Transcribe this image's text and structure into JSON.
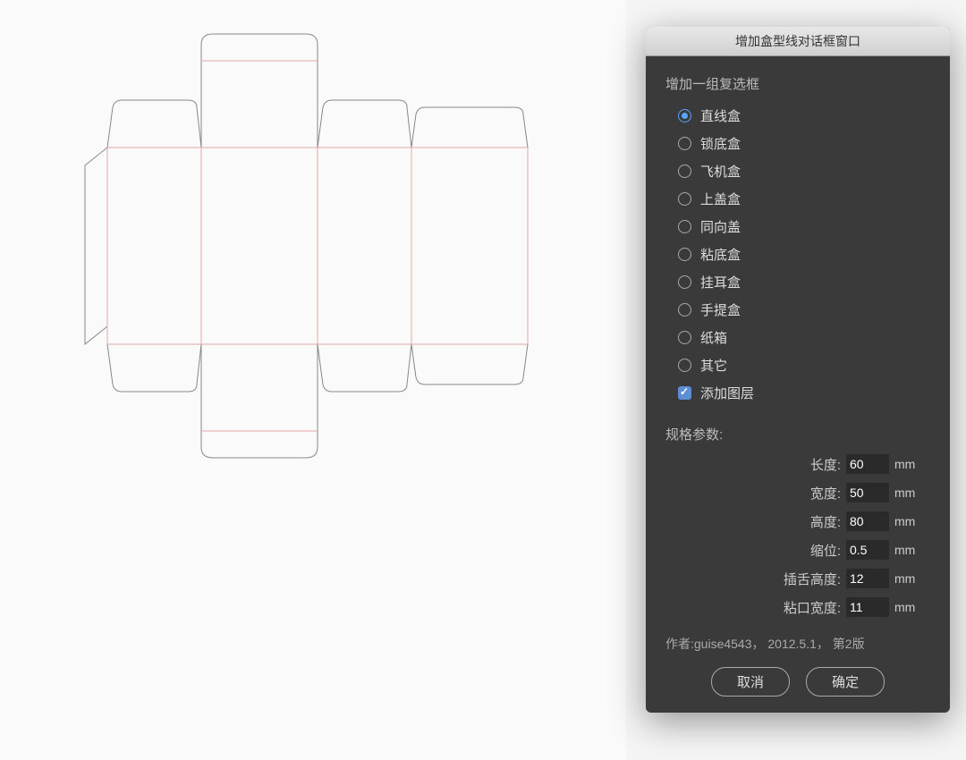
{
  "dialog": {
    "title": "增加盒型线对话框窗口",
    "group_label": "增加一组复选框",
    "options": [
      {
        "label": "直线盒",
        "selected": true
      },
      {
        "label": "锁底盒",
        "selected": false
      },
      {
        "label": "飞机盒",
        "selected": false
      },
      {
        "label": "上盖盒",
        "selected": false
      },
      {
        "label": "同向盖",
        "selected": false
      },
      {
        "label": "粘底盒",
        "selected": false
      },
      {
        "label": "挂耳盒",
        "selected": false
      },
      {
        "label": "手提盒",
        "selected": false
      },
      {
        "label": "纸箱",
        "selected": false
      },
      {
        "label": "其它",
        "selected": false
      }
    ],
    "checkbox": {
      "label": "添加图层",
      "checked": true
    },
    "params_label": "规格参数:",
    "params": [
      {
        "name": "长度:",
        "value": "60",
        "unit": "mm"
      },
      {
        "name": "宽度:",
        "value": "50",
        "unit": "mm"
      },
      {
        "name": "高度:",
        "value": "80",
        "unit": "mm"
      },
      {
        "name": "缩位:",
        "value": "0.5",
        "unit": "mm"
      },
      {
        "name": "插舌高度:",
        "value": "12",
        "unit": "mm"
      },
      {
        "name": "粘口宽度:",
        "value": "11",
        "unit": "mm"
      }
    ],
    "author_line": "作者:guise4543，  2012.5.1，  第2版",
    "cancel_label": "取消",
    "ok_label": "确定"
  }
}
